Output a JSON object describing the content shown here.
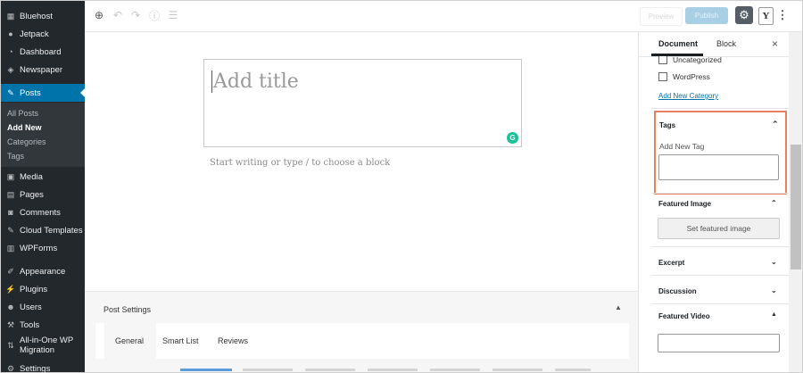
{
  "sidebar": {
    "items": [
      {
        "label": "Bluehost",
        "icon": "bluehost-icon"
      },
      {
        "label": "Jetpack",
        "icon": "jetpack-icon"
      },
      {
        "label": "Dashboard",
        "icon": "dashboard-icon"
      },
      {
        "label": "Newspaper",
        "icon": "newspaper-icon"
      },
      {
        "label": "Posts",
        "icon": "pin-icon"
      },
      {
        "label": "Media",
        "icon": "media-icon"
      },
      {
        "label": "Pages",
        "icon": "pages-icon"
      },
      {
        "label": "Comments",
        "icon": "comments-icon"
      },
      {
        "label": "Cloud Templates",
        "icon": "pin-icon"
      },
      {
        "label": "WPForms",
        "icon": "forms-icon"
      },
      {
        "label": "Appearance",
        "icon": "brush-icon"
      },
      {
        "label": "Plugins",
        "icon": "plug-icon"
      },
      {
        "label": "Users",
        "icon": "user-icon"
      },
      {
        "label": "Tools",
        "icon": "wrench-icon"
      },
      {
        "label": "All-in-One WP Migration",
        "icon": "migration-icon"
      },
      {
        "label": "Settings",
        "icon": "settings-icon"
      }
    ],
    "submenu": [
      "All Posts",
      "Add New",
      "Categories",
      "Tags"
    ]
  },
  "toolbar": {
    "draft_label": "Preview",
    "publish_label": "Publish",
    "yoast_label": "Y"
  },
  "editor": {
    "title_placeholder": "Add title",
    "block_placeholder": "Start writing or type / to choose a block"
  },
  "post_settings": {
    "title": "Post Settings",
    "tabs": [
      "General",
      "Smart List",
      "Reviews"
    ]
  },
  "panel": {
    "tab_document": "Document",
    "tab_block": "Block",
    "categories": [
      "Uncategorized",
      "WordPress"
    ],
    "add_category": "Add New Category",
    "tags_title": "Tags",
    "tags_label": "Add New Tag",
    "featured_image_title": "Featured Image",
    "featured_image_button": "Set featured image",
    "excerpt_title": "Excerpt",
    "discussion_title": "Discussion",
    "featured_video_title": "Featured Video"
  },
  "colors": {
    "admin_bg": "#23282d",
    "active_blue": "#0073aa",
    "highlight": "#e8805f",
    "grammarly": "#15c39a"
  }
}
